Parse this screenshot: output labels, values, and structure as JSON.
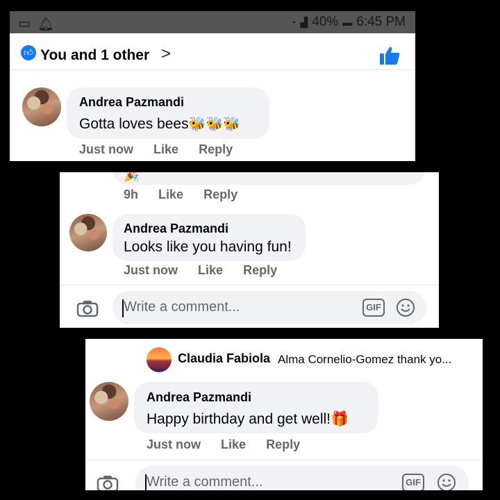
{
  "status_bar": {
    "battery": "40%",
    "time": "6:45 PM"
  },
  "reactions_header": {
    "likes_text": "You and 1 other",
    "chevron": ">"
  },
  "panel1_comment": {
    "author": "Andrea Pazmandi",
    "text": "Gotta loves bees",
    "emoji": "🐝🐝🐝",
    "time": "Just now",
    "like": "Like",
    "reply": "Reply"
  },
  "panel2_prev_meta": {
    "time": "9h",
    "like": "Like",
    "reply": "Reply"
  },
  "panel2_comment": {
    "author": "Andrea Pazmandi",
    "text": "Looks like you having fun!",
    "time": "Just now",
    "like": "Like",
    "reply": "Reply"
  },
  "comment_input": {
    "placeholder": "Write a comment...",
    "gif": "GIF"
  },
  "panel3_reply_preview": {
    "author": "Claudia Fabiola",
    "text": "Alma Cornelio-Gomez thank yo..."
  },
  "panel3_comment": {
    "author": "Andrea Pazmandi",
    "text": "Happy birthday and get well!",
    "emoji": "🎁",
    "time": "Just now",
    "like": "Like",
    "reply": "Reply"
  },
  "colors": {
    "facebook_blue": "#1877f2",
    "bubble_gray": "#f0f2f5",
    "meta_gray": "#65676b"
  },
  "icons": [
    "notification-icon",
    "bell-icon",
    "wifi-icon",
    "signal-icon",
    "battery-icon",
    "like-badge-icon",
    "chevron-right-icon",
    "thumbs-up-icon",
    "camera-icon",
    "gif-icon",
    "emoji-icon"
  ]
}
